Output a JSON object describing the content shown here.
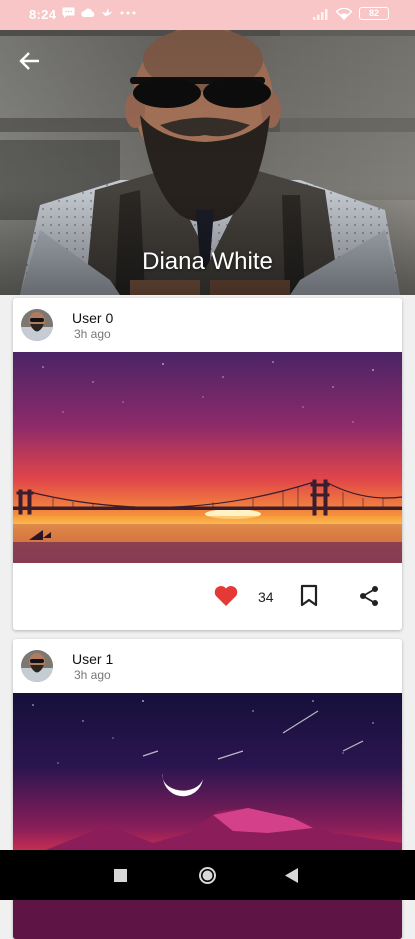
{
  "status_bar": {
    "time": "8:24",
    "battery": "82",
    "icons": [
      "chat-icon",
      "cloud-icon",
      "bird-icon",
      "more-dots-icon",
      "signal-icon",
      "wifi-icon",
      "battery-icon"
    ]
  },
  "header": {
    "profile_name": "Diana White",
    "back_icon": "arrow-left-icon"
  },
  "posts": [
    {
      "username": "User 0",
      "time": "3h ago",
      "likes": "34",
      "liked": true,
      "image": "sunset-bridge"
    },
    {
      "username": "User 1",
      "time": "3h ago",
      "image": "night-mountains"
    }
  ],
  "colors": {
    "status_bar": "#f8c6c6",
    "like_active": "#e53935",
    "nav_bar": "#000000"
  },
  "nav": [
    "recents-square-icon",
    "home-circle-icon",
    "back-triangle-icon"
  ]
}
